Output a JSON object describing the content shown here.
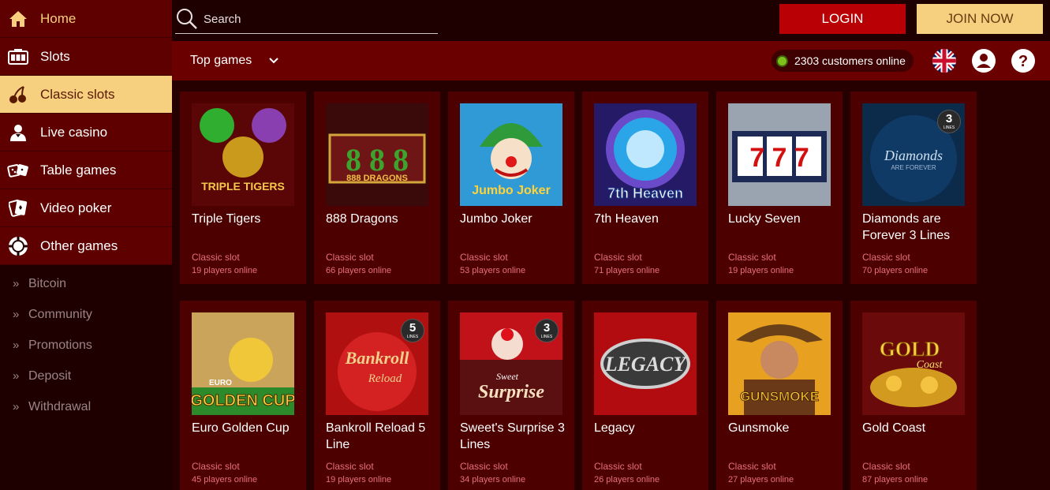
{
  "sidebar": {
    "main": [
      {
        "label": "Home",
        "icon": "home-icon"
      },
      {
        "label": "Slots",
        "icon": "slot-machine-icon"
      },
      {
        "label": "Classic slots",
        "icon": "cherries-icon"
      },
      {
        "label": "Live casino",
        "icon": "dealer-icon"
      },
      {
        "label": "Table games",
        "icon": "dice-icon"
      },
      {
        "label": "Video poker",
        "icon": "cards-icon"
      },
      {
        "label": "Other games",
        "icon": "chip-icon"
      }
    ],
    "secondary": [
      "Bitcoin",
      "Community",
      "Promotions",
      "Deposit",
      "Withdrawal"
    ]
  },
  "header": {
    "search_placeholder": "Search",
    "login_label": "LOGIN",
    "join_label": "JOIN NOW"
  },
  "subbar": {
    "filter_label": "Top games",
    "online_text": "2303 customers online"
  },
  "colors": {
    "background": "#260000",
    "card": "#4c0000",
    "accent_gold": "#f6cf7f",
    "login_red": "#b90005",
    "muted_pink": "#e8707a"
  },
  "games": [
    {
      "title": "Triple Tigers",
      "type": "Classic slot",
      "players": "19 players online",
      "art": "TRIPLE TIGERS"
    },
    {
      "title": "888 Dragons",
      "type": "Classic slot",
      "players": "66 players online",
      "art": "888 DRAGONS"
    },
    {
      "title": "Jumbo Joker",
      "type": "Classic slot",
      "players": "53 players online",
      "art": "Jumbo Joker"
    },
    {
      "title": "7th Heaven",
      "type": "Classic slot",
      "players": "71 players online",
      "art": "7th Heaven"
    },
    {
      "title": "Lucky Seven",
      "type": "Classic slot",
      "players": "19 players online",
      "art": "7 7 7"
    },
    {
      "title": "Diamonds are Forever 3 Lines",
      "type": "Classic slot",
      "players": "70 players online",
      "art": "Diamonds",
      "art_sub": "ARE FOREVER",
      "badge": "3",
      "badge_sub": "LINES"
    },
    {
      "title": "Euro Golden Cup",
      "type": "Classic slot",
      "players": "45 players online",
      "art": "GOLDEN CUP",
      "art_sub": "EURO"
    },
    {
      "title": "Bankroll Reload 5 Line",
      "type": "Classic slot",
      "players": "19 players online",
      "art": "Bankroll",
      "art_sub": "Reload",
      "badge": "5",
      "badge_sub": "LINES"
    },
    {
      "title": "Sweet's Surprise 3 Lines",
      "type": "Classic slot",
      "players": "34 players online",
      "art": "Surprise",
      "art_sub": "Sweet",
      "badge": "3",
      "badge_sub": "LINES"
    },
    {
      "title": "Legacy",
      "type": "Classic slot",
      "players": "26 players online",
      "art": "LEGACY"
    },
    {
      "title": "Gunsmoke",
      "type": "Classic slot",
      "players": "27 players online",
      "art": "GUNSMOKE"
    },
    {
      "title": "Gold Coast",
      "type": "Classic slot",
      "players": "87 players online",
      "art": "GOLD",
      "art_sub": "Coast"
    }
  ]
}
